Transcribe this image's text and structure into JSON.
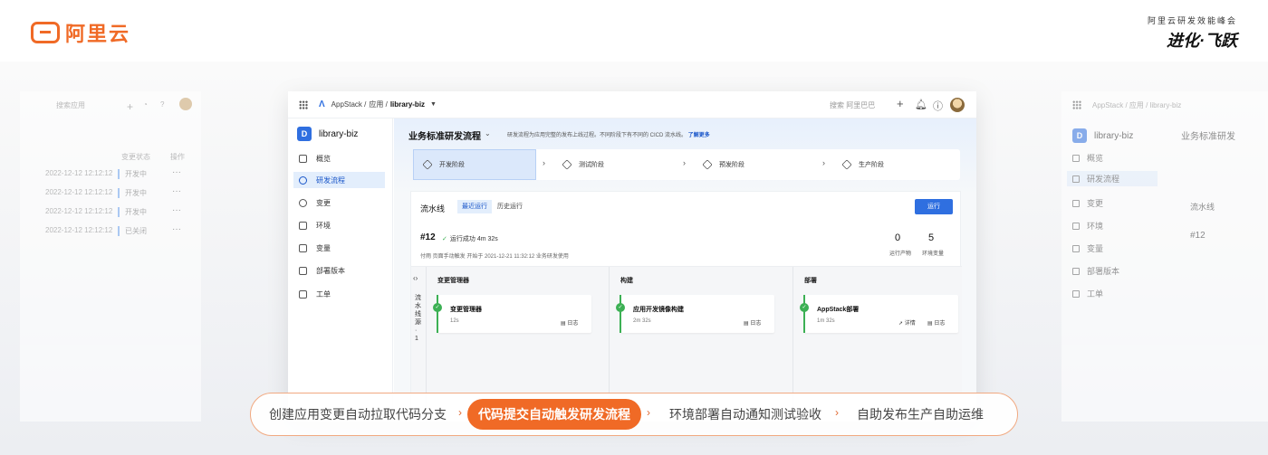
{
  "brand": {
    "name": "阿里云"
  },
  "summit": {
    "subtitle": "阿里云研发效能峰会",
    "title": "进化·飞跃"
  },
  "window": {
    "breadcrumb": {
      "root": "AppStack /",
      "section": "应用 /",
      "current": "library-biz"
    },
    "search_placeholder": "搜索 阿里巴巴"
  },
  "sidebar": {
    "app_badge": "D",
    "app_name": "library-biz",
    "items": [
      {
        "label": "概览"
      },
      {
        "label": "研发流程"
      },
      {
        "label": "变更"
      },
      {
        "label": "环境"
      },
      {
        "label": "变量"
      },
      {
        "label": "部署版本"
      },
      {
        "label": "工单"
      }
    ]
  },
  "flow": {
    "title": "业务标准研发流程",
    "description": "研发流程为应用完整的发布上线过程。不同阶段下有不同的 CICD 流水线。",
    "learn_more": "了解更多",
    "stages": [
      {
        "label": "开发阶段"
      },
      {
        "label": "测试阶段"
      },
      {
        "label": "预发阶段"
      },
      {
        "label": "生产阶段"
      }
    ]
  },
  "pipeline": {
    "title": "流水线",
    "tabs": [
      {
        "label": "最近运行"
      },
      {
        "label": "历史运行"
      }
    ],
    "run_button": "运行",
    "run": {
      "id": "#12",
      "status": "运行成功 4m 32s",
      "meta": "付雨 页面手动触发   开始于 2021-12-21 11:32:12   业务研发使用",
      "artifacts": {
        "value": "0",
        "label": "运行产物"
      },
      "variables": {
        "value": "5",
        "label": "环境变量"
      }
    },
    "vertical_label": "流水线源 · 1",
    "columns": [
      {
        "title": "变更管理器",
        "card": {
          "name": "变更管理器",
          "duration": "12s",
          "links": [
            "日志"
          ]
        }
      },
      {
        "title": "构建",
        "card": {
          "name": "应用开发镜像构建",
          "duration": "2m 32s",
          "links": [
            "日志"
          ]
        }
      },
      {
        "title": "部署",
        "card": {
          "name": "AppStack部署",
          "duration": "1m 32s",
          "links": [
            "详情",
            "日志"
          ]
        }
      }
    ]
  },
  "ghost_left": {
    "search": "搜索应用",
    "header": {
      "status": "变更状态",
      "ops": "操作"
    },
    "rows": [
      {
        "time": "2022-12-12 12:12:12",
        "status": "开发中"
      },
      {
        "time": "2022-12-12 12:12:12",
        "status": "开发中"
      },
      {
        "time": "2022-12-12 12:12:12",
        "status": "开发中"
      },
      {
        "time": "2022-12-12 12:12:12",
        "status": "已关闭"
      }
    ]
  },
  "ghost_right": {
    "breadcrumb": "AppStack / 应用 / library-biz",
    "app_name": "library-biz",
    "flow_title": "业务标准研发",
    "pipeline_title": "流水线",
    "run_id": "#12"
  },
  "process": {
    "steps": [
      {
        "label": "创建应用变更自动拉取代码分支"
      },
      {
        "label": "代码提交自动触发研发流程"
      },
      {
        "label": "环境部署自动通知测试验收"
      },
      {
        "label": "自助发布生产自助运维"
      }
    ],
    "active_index": 1
  },
  "colors": {
    "accent": "#f06a26",
    "primary": "#2f6fe0",
    "success": "#3cb054"
  }
}
